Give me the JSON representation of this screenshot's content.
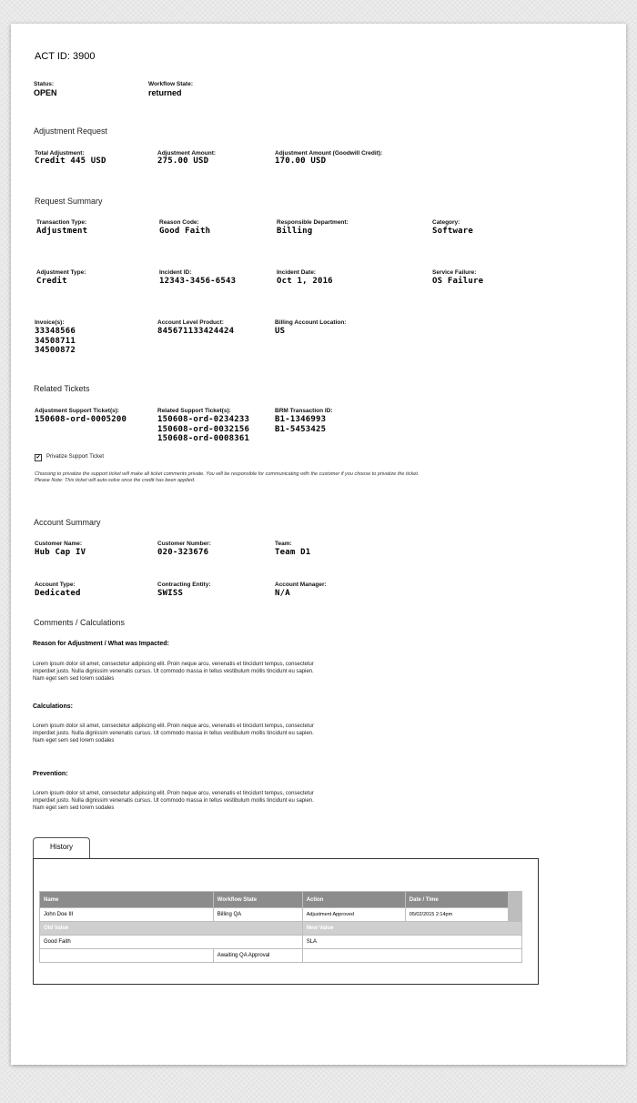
{
  "act_id": "ACT ID: 3900",
  "status": {
    "label": "Status:",
    "value": "OPEN"
  },
  "workflow_state": {
    "label": "Workflow State:",
    "value": "returned"
  },
  "adjustment_request": {
    "heading": "Adjustment Request",
    "total": {
      "label": "Total Adjustment:",
      "value": "Credit 445 USD"
    },
    "amount": {
      "label": "Adjustment Amount:",
      "value": "275.00 USD"
    },
    "goodwill": {
      "label": "Adjustment Amount (Goodwill Credit):",
      "value": "170.00 USD"
    }
  },
  "request_summary": {
    "heading": "Request Summary",
    "transaction_type": {
      "label": "Transaction Type:",
      "value": "Adjustment"
    },
    "reason_code": {
      "label": "Reason Code:",
      "value": "Good Faith"
    },
    "responsible_department": {
      "label": "Responsible Department:",
      "value": "Billing"
    },
    "category": {
      "label": "Category:",
      "value": "Software"
    },
    "adjustment_type": {
      "label": "Adjustment Type:",
      "value": "Credit"
    },
    "incident_id": {
      "label": "Incident ID:",
      "value": "12343-3456-6543"
    },
    "incident_date": {
      "label": "Incident Date:",
      "value": "Oct 1, 2016"
    },
    "service_failure": {
      "label": "Service Failure:",
      "value": "OS Failure"
    },
    "invoices": {
      "label": "Invoice(s):",
      "values": [
        "33348566",
        "34508711",
        "34500872"
      ]
    },
    "account_level_product": {
      "label": "Account Level Product:",
      "value": "845671133424424"
    },
    "billing_account_location": {
      "label": "Billing Account Location:",
      "value": "US"
    }
  },
  "related_tickets": {
    "heading": "Related Tickets",
    "adjustment_support": {
      "label": "Adjustment Support Ticket(s):",
      "value": "150608-ord-0005200"
    },
    "related_support": {
      "label": "Related Support Ticket(s):",
      "values": [
        "150608-ord-0234233",
        "150608-ord-0032156",
        "150608-ord-0008361"
      ]
    },
    "brm": {
      "label": "BRM Transaction ID:",
      "values": [
        "B1-1346993",
        "B1-5453425"
      ]
    },
    "privatize": {
      "label": "Privatize Support Ticket",
      "checked": true,
      "check_glyph": "✔"
    },
    "note_line1": "Choosing to privatize the support ticket will make all ticket comments private. You will be responsible for communicating with the customer if you choose to privatize the ticket.",
    "note_line2": "Please Note: This ticket will auto-solve once the credit has been applied."
  },
  "account_summary": {
    "heading": "Account Summary",
    "customer_name": {
      "label": "Customer Name:",
      "value": "Hub Cap IV"
    },
    "customer_number": {
      "label": "Customer Number:",
      "value": "020-323676"
    },
    "team": {
      "label": "Team:",
      "value": "Team D1"
    },
    "account_type": {
      "label": "Account Type:",
      "value": "Dedicated"
    },
    "contracting_entity": {
      "label": "Contracting Entity:",
      "value": "SWISS"
    },
    "account_manager": {
      "label": "Account Manager:",
      "value": "N/A"
    }
  },
  "comments": {
    "heading": "Comments / Calculations",
    "reason": {
      "title": "Reason for Adjustment / What was Impacted:",
      "lines": [
        "Lorem ipsum dolor sit amet, consectetur adipiscing elit. Proin neque arcu, venenatis et tincidunt tempus, consectetur",
        "imperdiet justo. Nulla dignissim venenatis cursus. Ut commodo massa in tellus vestibulum mollis tincidunt eu sapien.",
        "Nam eget sem sed lorem sodales"
      ]
    },
    "calculations": {
      "title": "Calculations:",
      "lines": [
        "Lorem ipsum dolor sit amet, consectetur adipiscing elit. Proin neque arcu, venenatis et tincidunt tempus, consectetur",
        "imperdiet justo. Nulla dignissim venenatis cursus. Ut commodo massa in tellus vestibulum mollis tincidunt eu sapien.",
        "Nam eget sem sed lorem sodales"
      ]
    },
    "prevention": {
      "title": "Prevention:",
      "lines": [
        "Lorem ipsum dolor sit amet, consectetur adipiscing elit. Proin neque arcu, venenatis et tincidunt tempus, consectetur",
        "imperdiet justo. Nulla dignissim venenatis cursus. Ut commodo massa in tellus vestibulum mollis tincidunt eu sapien.",
        "Nam eget sem sed lorem sodales"
      ]
    }
  },
  "history": {
    "tab_label": "History",
    "columns": [
      "Name",
      "Workflow State",
      "Action",
      "Date / Time"
    ],
    "row": {
      "name": "John Doe III",
      "workflow_state": "Billing QA",
      "action": "Adjustment Approved",
      "datetime": "05/02/2015 2:14pm"
    },
    "sub_columns": [
      "Old Value",
      "New Value"
    ],
    "sub_row": {
      "old": "Good Faith",
      "new": "SLA"
    },
    "extra_row": {
      "value": "Awaiting QA Approval"
    }
  }
}
